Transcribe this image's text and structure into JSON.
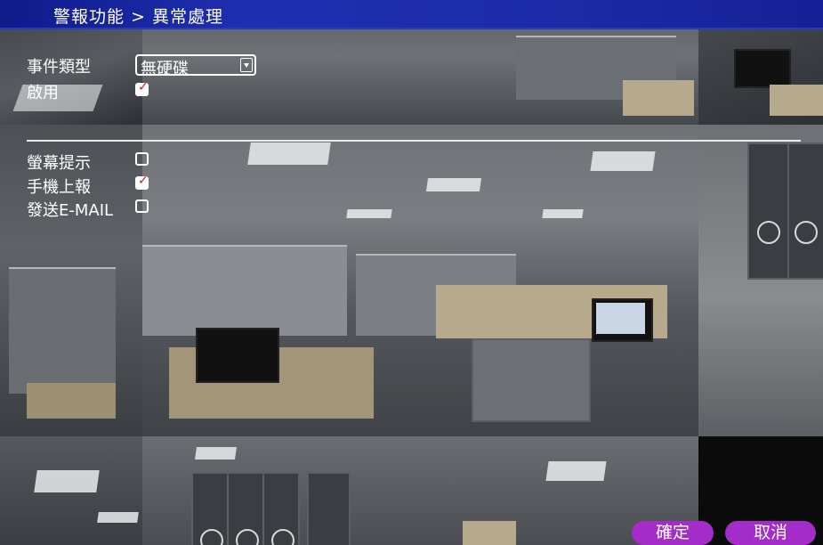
{
  "title": "警報功能 > 異常處理",
  "form": {
    "event_type": {
      "label": "事件類型",
      "value": "無硬碟"
    },
    "enable": {
      "label": "啟用",
      "checked": true
    }
  },
  "actions": [
    {
      "label": "螢幕提示",
      "checked": false
    },
    {
      "label": "手機上報",
      "checked": true
    },
    {
      "label": "發送E-MAIL",
      "checked": false
    }
  ],
  "buttons": {
    "ok": "確定",
    "cancel": "取消"
  },
  "colors": {
    "title_bar": "#1c2aa6",
    "button": "#a42cc8",
    "check_mark": "#d11a1a"
  },
  "icons": {
    "dropdown": "chevron-down-icon",
    "check": "check-icon"
  }
}
